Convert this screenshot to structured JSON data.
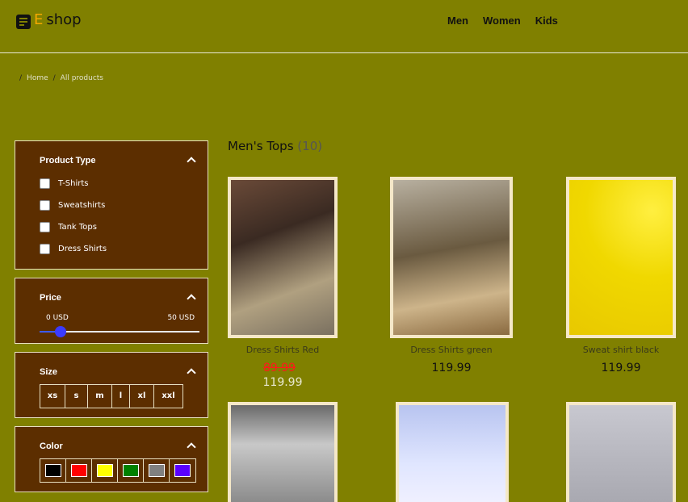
{
  "brand": {
    "letter": "E",
    "name": "shop"
  },
  "nav": [
    "Men",
    "Women",
    "Kids"
  ],
  "breadcrumb": {
    "items": [
      "Home",
      "All products"
    ],
    "separator": "/"
  },
  "filters": {
    "product_type": {
      "title": "Product Type",
      "options": [
        "T-Shirts",
        "Sweatshirts",
        "Tank Tops",
        "Dress Shirts"
      ]
    },
    "price": {
      "title": "Price",
      "min_label": "0 USD",
      "max_label": "50 USD",
      "value_fraction": 0.13
    },
    "size": {
      "title": "Size",
      "options": [
        "xs",
        "s",
        "m",
        "l",
        "xl",
        "xxl"
      ]
    },
    "color": {
      "title": "Color",
      "swatches": [
        "#000000",
        "#ff0000",
        "#ffff00",
        "#008000",
        "#808080",
        "#5a00ff"
      ]
    }
  },
  "category": {
    "title": "Men's Tops",
    "count": "(10)"
  },
  "products": [
    {
      "name": "Dress Shirts Red",
      "sale_price": "89.99",
      "price": "119.99"
    },
    {
      "name": "Dress Shirts green",
      "price": "119.99"
    },
    {
      "name": "Sweat shirt black",
      "price": "119.99"
    },
    {
      "name": "",
      "price": ""
    },
    {
      "name": "",
      "price": ""
    },
    {
      "name": "",
      "price": ""
    }
  ]
}
